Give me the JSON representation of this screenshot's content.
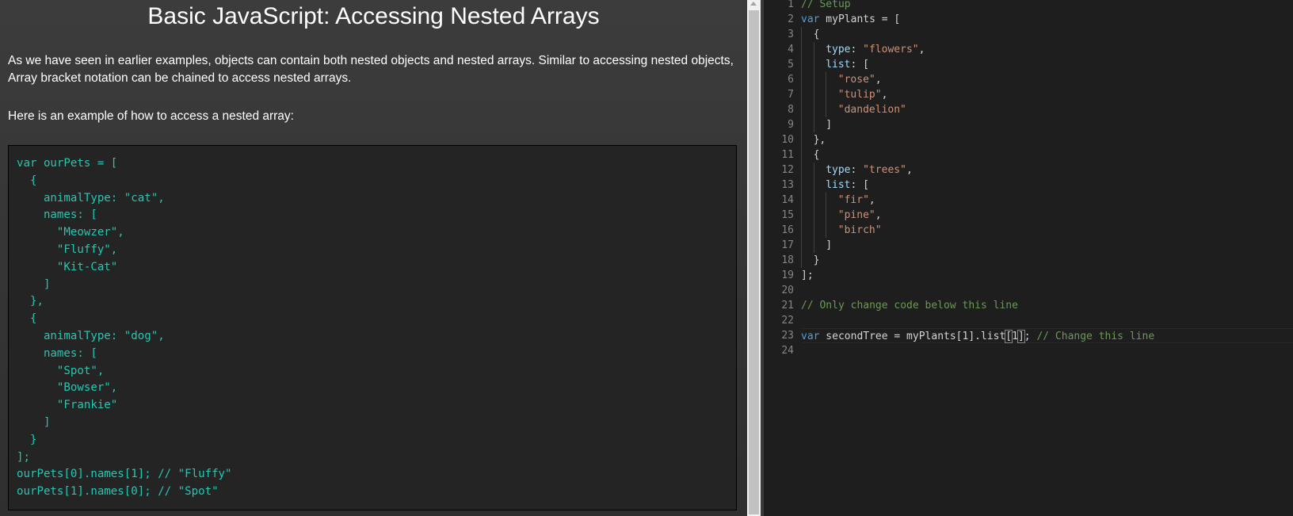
{
  "lesson": {
    "title": "Basic JavaScript: Accessing Nested Arrays",
    "intro": "As we have seen in earlier examples, objects can contain both nested objects and nested arrays. Similar to accessing nested objects, Array bracket notation can be chained to access nested arrays.",
    "example_intro": "Here is an example of how to access a nested array:",
    "example_code": "var ourPets = [\n  {\n    animalType: \"cat\",\n    names: [\n      \"Meowzer\",\n      \"Fluffy\",\n      \"Kit-Cat\"\n    ]\n  },\n  {\n    animalType: \"dog\",\n    names: [\n      \"Spot\",\n      \"Bowser\",\n      \"Frankie\"\n    ]\n  }\n];\nourPets[0].names[1]; // \"Fluffy\"\nourPets[1].names[0]; // \"Spot\""
  },
  "editor": {
    "line_numbers": [
      "1",
      "2",
      "3",
      "4",
      "5",
      "6",
      "7",
      "8",
      "9",
      "10",
      "11",
      "12",
      "13",
      "14",
      "15",
      "16",
      "17",
      "18",
      "19",
      "20",
      "21",
      "22",
      "23",
      "24"
    ],
    "lines": [
      [
        {
          "t": "// Setup",
          "c": "cm"
        }
      ],
      [
        {
          "t": "var",
          "c": "kw"
        },
        {
          "t": " myPlants = [",
          "c": ""
        }
      ],
      [
        {
          "g": 1
        },
        {
          "t": "{",
          "c": ""
        }
      ],
      [
        {
          "g": 2
        },
        {
          "t": "type",
          "c": "prop"
        },
        {
          "t": ": ",
          "c": ""
        },
        {
          "t": "\"flowers\"",
          "c": "str"
        },
        {
          "t": ",",
          "c": ""
        }
      ],
      [
        {
          "g": 2
        },
        {
          "t": "list",
          "c": "prop"
        },
        {
          "t": ": [",
          "c": ""
        }
      ],
      [
        {
          "g": 3
        },
        {
          "t": "\"rose\"",
          "c": "str"
        },
        {
          "t": ",",
          "c": ""
        }
      ],
      [
        {
          "g": 3
        },
        {
          "t": "\"tulip\"",
          "c": "str"
        },
        {
          "t": ",",
          "c": ""
        }
      ],
      [
        {
          "g": 3
        },
        {
          "t": "\"dandelion\"",
          "c": "str"
        }
      ],
      [
        {
          "g": 2
        },
        {
          "t": "]",
          "c": ""
        }
      ],
      [
        {
          "g": 1
        },
        {
          "t": "},",
          "c": ""
        }
      ],
      [
        {
          "g": 1
        },
        {
          "t": "{",
          "c": ""
        }
      ],
      [
        {
          "g": 2
        },
        {
          "t": "type",
          "c": "prop"
        },
        {
          "t": ": ",
          "c": ""
        },
        {
          "t": "\"trees\"",
          "c": "str"
        },
        {
          "t": ",",
          "c": ""
        }
      ],
      [
        {
          "g": 2
        },
        {
          "t": "list",
          "c": "prop"
        },
        {
          "t": ": [",
          "c": ""
        }
      ],
      [
        {
          "g": 3
        },
        {
          "t": "\"fir\"",
          "c": "str"
        },
        {
          "t": ",",
          "c": ""
        }
      ],
      [
        {
          "g": 3
        },
        {
          "t": "\"pine\"",
          "c": "str"
        },
        {
          "t": ",",
          "c": ""
        }
      ],
      [
        {
          "g": 3
        },
        {
          "t": "\"birch\"",
          "c": "str"
        }
      ],
      [
        {
          "g": 2
        },
        {
          "t": "]",
          "c": ""
        }
      ],
      [
        {
          "g": 1
        },
        {
          "t": "}",
          "c": ""
        }
      ],
      [
        {
          "t": "];",
          "c": ""
        }
      ],
      [],
      [
        {
          "t": "// Only change code below this line",
          "c": "cm"
        }
      ],
      [],
      [
        {
          "t": "var",
          "c": "kw"
        },
        {
          "t": " secondTree = myPlants[1].list",
          "c": ""
        },
        {
          "t": "[",
          "c": "bracket"
        },
        {
          "t": "1",
          "c": ""
        },
        {
          "t": "]",
          "c": "bracket"
        },
        {
          "t": "; ",
          "c": ""
        },
        {
          "t": "// Change this line",
          "c": "cm"
        }
      ],
      []
    ],
    "active_line": 23,
    "colors": {
      "keyword": "#569cd6",
      "string": "#ce9178",
      "comment": "#6a9955",
      "property": "#9cdcfe",
      "example_code": "#26c6b0"
    }
  }
}
